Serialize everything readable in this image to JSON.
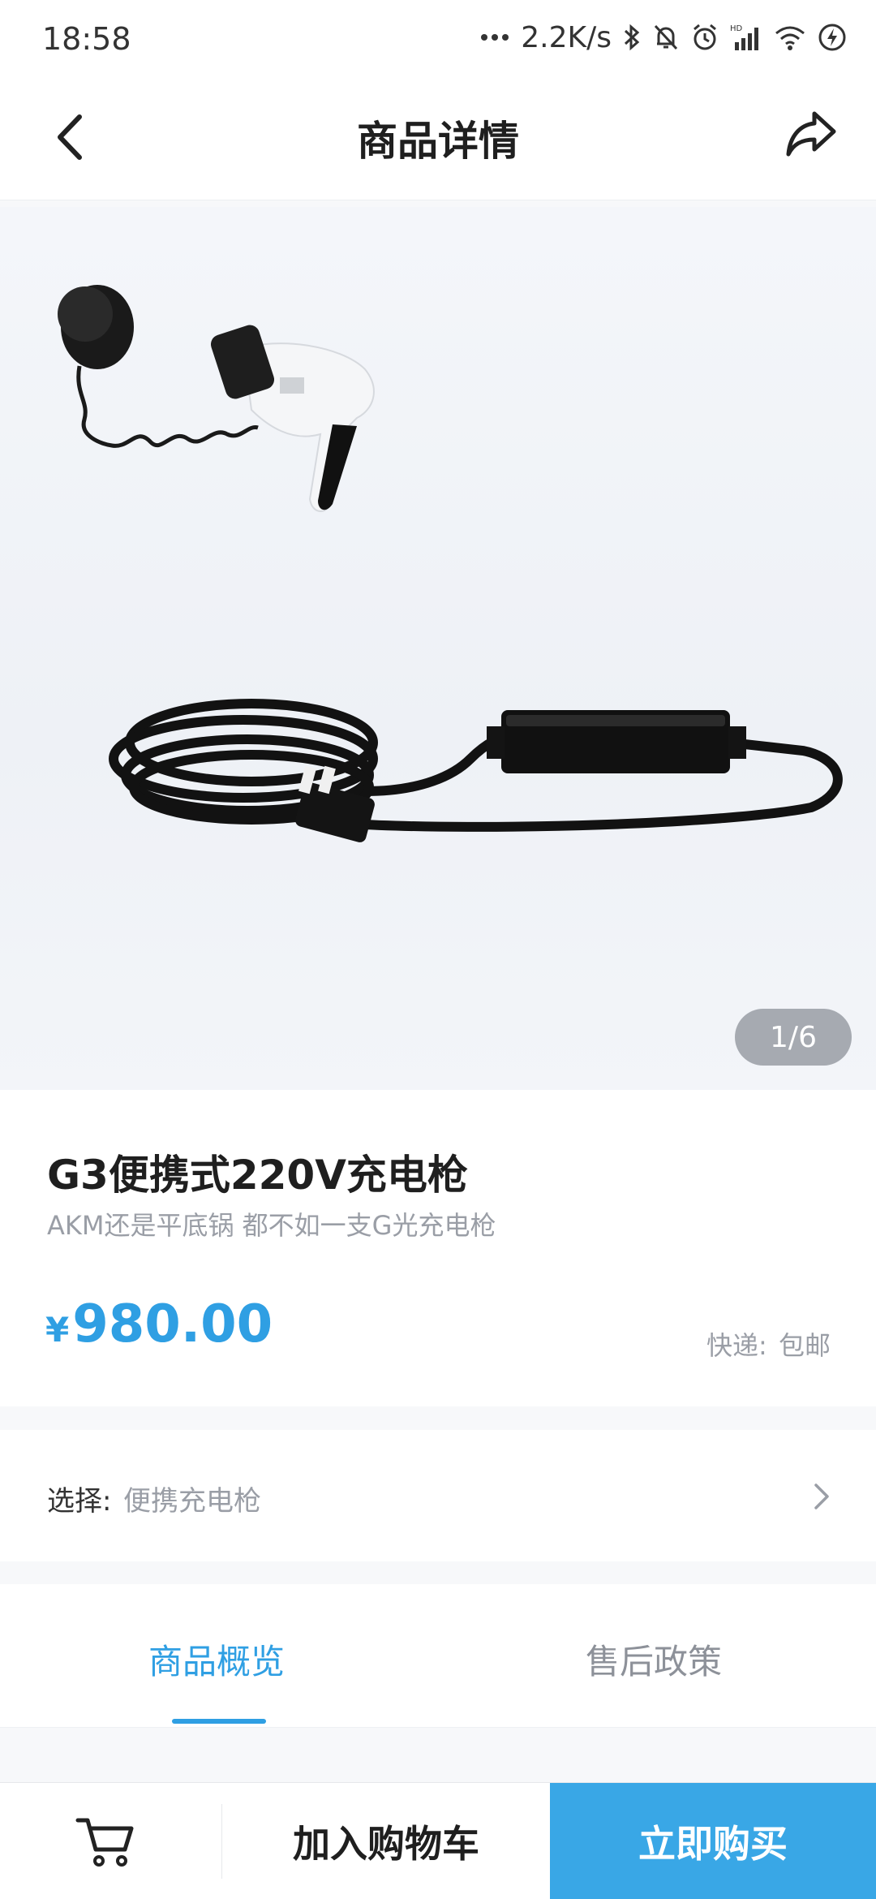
{
  "status_bar": {
    "time": "18:58",
    "net_speed": "2.2K/s",
    "icons": [
      "more-dots-icon",
      "bluetooth-icon",
      "mute-bell-icon",
      "alarm-icon",
      "hd-signal-icon",
      "wifi-icon",
      "battery-charging-icon"
    ]
  },
  "header": {
    "title": "商品详情",
    "back_icon": "back-chevron-icon",
    "share_icon": "share-arrow-icon"
  },
  "gallery": {
    "counter": "1/6"
  },
  "product": {
    "name": "G3便携式220V充电枪",
    "subtitle": "AKM还是平底锅 都不如一支G光充电枪",
    "currency": "¥",
    "price": "980.00",
    "shipping_label": "快递:",
    "shipping_value": "包邮"
  },
  "options": {
    "label": "选择:",
    "value": "便携充电枪"
  },
  "tabs": [
    {
      "label": "商品概览",
      "active": true
    },
    {
      "label": "售后政策",
      "active": false
    }
  ],
  "bottom_bar": {
    "cart_icon": "cart-icon",
    "add_to_cart": "加入购物车",
    "buy_now": "立即购买"
  },
  "colors": {
    "accent": "#2f9fe3",
    "buy_button": "#39a7e6",
    "progress": "#52c41a",
    "muted_text": "#9a9ea6"
  }
}
